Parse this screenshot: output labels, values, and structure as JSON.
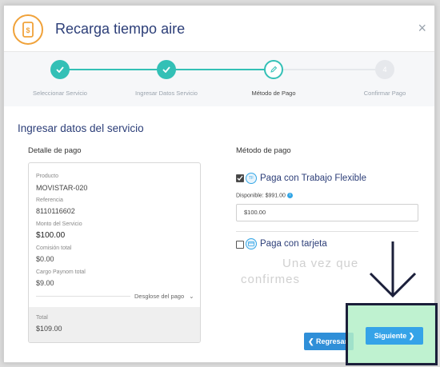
{
  "header": {
    "title": "Recarga tiempo aire",
    "close": "×"
  },
  "steps": [
    {
      "label": "Seleccionar Servicio",
      "state": "done"
    },
    {
      "label": "Ingresar Datos Servicio",
      "state": "done"
    },
    {
      "label": "Método de Pago",
      "state": "active"
    },
    {
      "label": "Confirmar Pago",
      "state": "todo",
      "number": "4"
    }
  ],
  "section_title": "Ingresar datos del servicio",
  "detail": {
    "title": "Detalle de pago",
    "producto_label": "Producto",
    "producto": "MOVISTAR-020",
    "referencia_label": "Referencia",
    "referencia": "8110116602",
    "monto_label": "Monto del Servicio",
    "monto": "$100.00",
    "comision_label": "Comisión total",
    "comision": "$0.00",
    "cargo_label": "Cargo Paynom total",
    "cargo": "$9.00",
    "desglose": "Desglose del pago",
    "total_label": "Total",
    "total": "$109.00"
  },
  "method": {
    "title": "Método de pago",
    "flex_label": "Paga con Trabajo Flexible",
    "flex_icon_text": "TF",
    "flex_checked": true,
    "disponible": "Disponible: $991.00",
    "amount": "$100.00",
    "card_label": "Paga con tarjeta",
    "card_checked": false
  },
  "ghost": {
    "line1": "Una vez que",
    "line2": "confirmes"
  },
  "buttons": {
    "back": "❮ Regresar",
    "next": "Siguiente ❯"
  },
  "colors": {
    "accent": "#33c0b6",
    "primary": "#2f8fd8",
    "title": "#2c3e78",
    "highlight": "#b4f0c8"
  }
}
